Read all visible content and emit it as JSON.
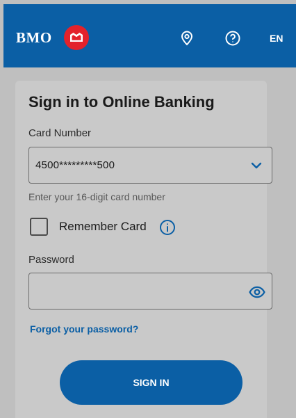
{
  "header": {
    "brand": "BMO",
    "language": "EN",
    "colors": {
      "primary": "#0b5fa5",
      "brand_red": "#e3222b"
    },
    "icons": [
      "location-pin-icon",
      "help-icon"
    ]
  },
  "form": {
    "title": "Sign in to Online Banking",
    "card_number": {
      "label": "Card Number",
      "value": "4500*********500",
      "helper": "Enter your 16-digit card number"
    },
    "remember": {
      "label": "Remember Card",
      "checked": false
    },
    "password": {
      "label": "Password",
      "value": ""
    },
    "forgot_link": "Forgot your password?",
    "submit_label": "SIGN IN"
  }
}
